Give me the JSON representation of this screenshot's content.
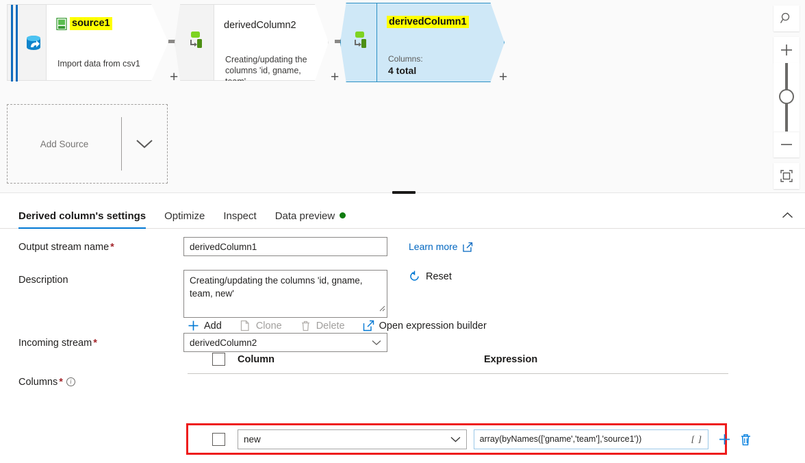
{
  "canvas": {
    "nodes": [
      {
        "id": "source1",
        "name": "source1",
        "subtitle": "Import data from csv1",
        "icon": "csv-file-icon",
        "rail_icon": "database-cylinder-icon",
        "highlighted": true,
        "plus_label": "+"
      },
      {
        "id": "derivedColumn2",
        "name": "derivedColumn2",
        "subtitle": "Creating/updating the columns 'id, gname, team'",
        "icon": "derived-column-icon",
        "highlighted": false,
        "plus_label": "+"
      },
      {
        "id": "derivedColumn1",
        "name": "derivedColumn1",
        "columns_caption": "Columns:",
        "columns_value": "4 total",
        "icon": "derived-column-icon",
        "highlighted": true,
        "selected": true,
        "plus_label": "+"
      }
    ],
    "add_source": {
      "label": "Add Source",
      "caret_icon": "chevron-down-icon"
    },
    "tools": {
      "search_icon": "search-zoom-icon",
      "zoom_in_label": "+",
      "zoom_out_label": "—",
      "fit_icon": "fit-to-screen-icon"
    }
  },
  "panel": {
    "tabs": [
      {
        "label": "Derived column's settings",
        "active": true,
        "dot": false
      },
      {
        "label": "Optimize",
        "active": false,
        "dot": false
      },
      {
        "label": "Inspect",
        "active": false,
        "dot": false
      },
      {
        "label": "Data preview",
        "active": false,
        "dot": true
      }
    ],
    "collapse_icon": "chevron-up-icon",
    "fields": {
      "output_stream_label": "Output stream name",
      "output_stream_value": "derivedColumn1",
      "output_stream_placeholder": "Output stream name",
      "description_label": "Description",
      "description_value": "Creating/updating the columns 'id, gname, team, new'",
      "description_placeholder": "Description",
      "incoming_stream_label": "Incoming stream",
      "incoming_stream_value": "derivedColumn2",
      "columns_label": "Columns"
    },
    "links": {
      "learn_more": "Learn more",
      "learn_more_icon": "external-link-icon",
      "reset": "Reset",
      "reset_icon": "refresh-circle-icon"
    },
    "commands": [
      {
        "label": "Add",
        "icon": "plus-icon",
        "enabled": true
      },
      {
        "label": "Clone",
        "icon": "copy-icon",
        "enabled": false
      },
      {
        "label": "Delete",
        "icon": "trash-icon",
        "enabled": false
      },
      {
        "label": "Open expression builder",
        "icon": "external-link-icon",
        "enabled": true
      }
    ],
    "grid": {
      "headers": {
        "column": "Column",
        "expression": "Expression"
      },
      "rows": [
        {
          "column": "new",
          "expression": "array(byNames(['gname','team'],'source1'))",
          "brackets": "[ ]",
          "add_icon": "plus-icon",
          "delete_icon": "trash-icon"
        }
      ]
    }
  },
  "colors": {
    "accent": "#0078d4",
    "highlight": "#ffff00",
    "selected_node": "#cfe8f7",
    "selected_border": "#2a8fc4",
    "error_outline": "#ee1c1c",
    "status_green": "#107c10",
    "required": "#a4262c"
  }
}
